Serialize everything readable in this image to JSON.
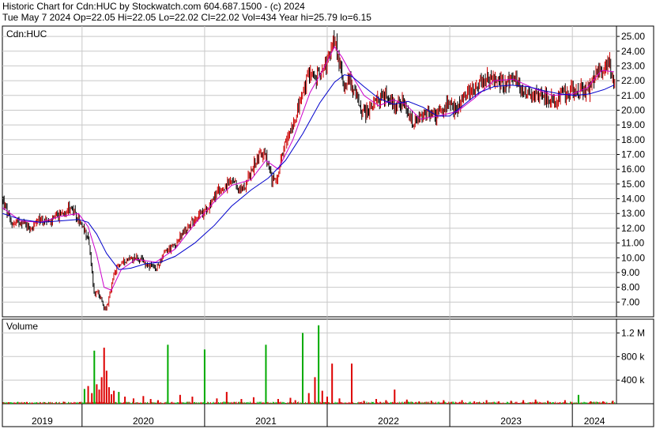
{
  "header": {
    "line1": "Historic Chart for Cdn:HUC by Stockwatch.com 604.687.1500 - (c) 2024",
    "line2": "Tue May  7 2024  Op=22.05  Hi=22.05  Lo=22.02  Cl=22.02  Vol=434  Year hi=25.79  lo=6.15"
  },
  "colors": {
    "candle_up": "#cc0000",
    "candle_down": "#000000",
    "ma_short": "#cc00cc",
    "ma_long": "#0000cc",
    "grid": "#c8c8c8",
    "vol_green": "#00aa00",
    "vol_red": "#dd0000"
  },
  "chart_data": [
    {
      "type": "line",
      "panel": "price",
      "title": "Cdn:HUC",
      "y_ticks": [
        "7.00",
        "8.00",
        "9.00",
        "10.00",
        "11.00",
        "12.00",
        "13.00",
        "14.00",
        "15.00",
        "16.00",
        "17.00",
        "18.00",
        "19.00",
        "20.00",
        "21.00",
        "22.00",
        "23.00",
        "24.00",
        "25.00"
      ],
      "ylim": [
        6.0,
        25.7
      ],
      "x_ticks": [
        "2019",
        "2020",
        "2021",
        "2022",
        "2023",
        "2024"
      ],
      "x_tick_pos": [
        2019.6,
        2020.0,
        2021.0,
        2022.0,
        2023.0,
        2024.0
      ],
      "xlim": [
        2019.35,
        2024.36
      ],
      "grid": true,
      "series": [
        {
          "key": "close",
          "x": [
            2019.35,
            2019.42,
            2019.5,
            2019.58,
            2019.66,
            2019.74,
            2019.82,
            2019.9,
            2019.97,
            2020.05,
            2020.1,
            2020.13,
            2020.16,
            2020.18,
            2020.2,
            2020.22,
            2020.26,
            2020.3,
            2020.36,
            2020.44,
            2020.52,
            2020.6,
            2020.68,
            2020.76,
            2020.84,
            2020.92,
            2021.0,
            2021.08,
            2021.16,
            2021.22,
            2021.3,
            2021.38,
            2021.45,
            2021.5,
            2021.55,
            2021.6,
            2021.66,
            2021.72,
            2021.8,
            2021.86,
            2021.9,
            2021.94,
            2021.97,
            2022.0,
            2022.03,
            2022.06,
            2022.1,
            2022.14,
            2022.18,
            2022.24,
            2022.3,
            2022.36,
            2022.42,
            2022.48,
            2022.54,
            2022.6,
            2022.64,
            2022.7,
            2022.76,
            2022.82,
            2022.9,
            2022.98,
            2023.06,
            2023.12,
            2023.2,
            2023.28,
            2023.36,
            2023.44,
            2023.52,
            2023.6,
            2023.68,
            2023.76,
            2023.84,
            2023.92,
            2024.0,
            2024.06,
            2024.12,
            2024.18,
            2024.24,
            2024.3,
            2024.34
          ],
          "values": [
            14.0,
            12.3,
            12.5,
            12.0,
            12.6,
            12.4,
            12.9,
            13.5,
            12.5,
            11.4,
            7.5,
            7.8,
            7.0,
            6.5,
            6.7,
            7.2,
            8.8,
            9.5,
            9.9,
            10.0,
            9.6,
            9.2,
            10.4,
            10.9,
            11.8,
            12.7,
            13.1,
            14.2,
            14.8,
            15.1,
            14.5,
            15.8,
            17.2,
            16.8,
            15.1,
            15.7,
            17.7,
            19.2,
            21.0,
            22.8,
            22.0,
            22.6,
            23.2,
            23.2,
            23.9,
            25.0,
            23.0,
            21.8,
            22.1,
            20.8,
            19.8,
            20.2,
            20.7,
            21.0,
            20.4,
            20.6,
            20.0,
            19.0,
            19.4,
            19.8,
            19.6,
            20.3,
            20.1,
            20.9,
            21.6,
            22.1,
            22.0,
            21.9,
            22.1,
            21.4,
            21.0,
            21.2,
            20.6,
            21.0,
            21.3,
            21.4,
            21.2,
            22.3,
            22.8,
            23.4,
            22.0
          ],
          "name": ""
        },
        {
          "key": "ma_short",
          "x": [
            2019.35,
            2019.5,
            2019.66,
            2019.82,
            2019.97,
            2020.05,
            2020.12,
            2020.18,
            2020.24,
            2020.32,
            2020.44,
            2020.6,
            2020.76,
            2020.92,
            2021.08,
            2021.22,
            2021.38,
            2021.5,
            2021.6,
            2021.72,
            2021.86,
            2021.97,
            2022.06,
            2022.12,
            2022.2,
            2022.3,
            2022.42,
            2022.54,
            2022.64,
            2022.76,
            2022.9,
            2023.06,
            2023.2,
            2023.36,
            2023.52,
            2023.68,
            2023.84,
            2024.0,
            2024.12,
            2024.24,
            2024.34
          ],
          "values": [
            13.4,
            12.5,
            12.4,
            12.8,
            13.0,
            12.1,
            10.2,
            8.0,
            7.8,
            9.2,
            9.9,
            9.7,
            10.6,
            12.3,
            13.8,
            14.9,
            15.3,
            16.6,
            16.0,
            18.0,
            21.2,
            22.8,
            24.3,
            23.6,
            22.4,
            21.0,
            20.3,
            20.7,
            20.4,
            19.4,
            19.6,
            19.9,
            20.8,
            22.0,
            22.1,
            21.5,
            21.0,
            21.1,
            21.5,
            22.7,
            22.6
          ],
          "name": ""
        },
        {
          "key": "ma_long",
          "x": [
            2019.35,
            2019.5,
            2019.66,
            2019.82,
            2019.97,
            2020.05,
            2020.12,
            2020.2,
            2020.3,
            2020.4,
            2020.52,
            2020.64,
            2020.76,
            2020.92,
            2021.08,
            2021.22,
            2021.38,
            2021.52,
            2021.66,
            2021.8,
            2021.94,
            2022.06,
            2022.14,
            2022.2,
            2022.3,
            2022.42,
            2022.54,
            2022.66,
            2022.78,
            2022.9,
            2023.0,
            2023.12,
            2023.24,
            2023.36,
            2023.5,
            2023.64,
            2023.78,
            2023.9,
            2024.02,
            2024.14,
            2024.26,
            2024.34
          ],
          "values": [
            13.0,
            12.6,
            12.4,
            12.5,
            12.6,
            12.4,
            11.6,
            10.3,
            9.2,
            9.3,
            9.6,
            9.7,
            10.1,
            11.0,
            12.2,
            13.5,
            14.6,
            15.4,
            16.6,
            18.4,
            20.5,
            21.9,
            22.4,
            22.3,
            21.6,
            20.8,
            20.4,
            20.6,
            20.2,
            19.6,
            19.6,
            20.4,
            21.2,
            21.6,
            21.7,
            21.6,
            21.3,
            21.1,
            21.0,
            21.1,
            21.4,
            21.7
          ],
          "name": ""
        }
      ]
    },
    {
      "type": "bar",
      "panel": "volume",
      "title": "Volume",
      "y_ticks": [
        "400 k",
        "800 k",
        "1.2 M"
      ],
      "ylim": [
        0,
        1380000
      ],
      "x": [
        2019.4,
        2019.55,
        2019.7,
        2019.85,
        2019.98,
        2020.02,
        2020.05,
        2020.08,
        2020.1,
        2020.12,
        2020.14,
        2020.16,
        2020.18,
        2020.2,
        2020.22,
        2020.24,
        2020.26,
        2020.3,
        2020.35,
        2020.42,
        2020.5,
        2020.56,
        2020.62,
        2020.7,
        2020.8,
        2020.9,
        2021.0,
        2021.1,
        2021.18,
        2021.3,
        2021.4,
        2021.5,
        2021.6,
        2021.7,
        2021.74,
        2021.8,
        2021.85,
        2021.9,
        2021.93,
        2021.96,
        2022.0,
        2022.04,
        2022.1,
        2022.2,
        2022.3,
        2022.4,
        2022.48,
        2022.55,
        2022.65,
        2022.75,
        2022.85,
        2022.95,
        2023.1,
        2023.2,
        2023.3,
        2023.4,
        2023.5,
        2023.6,
        2023.7,
        2023.8,
        2023.94,
        2024.05,
        2024.15,
        2024.25,
        2024.33
      ],
      "values": [
        25000,
        30000,
        20000,
        35000,
        28000,
        250000,
        300000,
        180000,
        900000,
        330000,
        240000,
        450000,
        950000,
        560000,
        280000,
        160000,
        220000,
        200000,
        120000,
        90000,
        130000,
        80000,
        60000,
        1000000,
        150000,
        120000,
        920000,
        90000,
        200000,
        80000,
        110000,
        1000000,
        80000,
        100000,
        60000,
        1200000,
        180000,
        450000,
        1330000,
        220000,
        120000,
        680000,
        90000,
        680000,
        50000,
        80000,
        60000,
        240000,
        70000,
        40000,
        50000,
        60000,
        60000,
        40000,
        60000,
        40000,
        50000,
        60000,
        70000,
        50000,
        60000,
        150000,
        40000,
        40000,
        50000
      ],
      "colors": [
        "r",
        "r",
        "r",
        "r",
        "r",
        "g",
        "r",
        "r",
        "g",
        "r",
        "r",
        "r",
        "r",
        "r",
        "r",
        "r",
        "r",
        "g",
        "r",
        "r",
        "r",
        "r",
        "r",
        "g",
        "r",
        "r",
        "g",
        "r",
        "r",
        "r",
        "r",
        "g",
        "r",
        "r",
        "r",
        "g",
        "r",
        "r",
        "g",
        "r",
        "r",
        "r",
        "r",
        "r",
        "r",
        "r",
        "r",
        "r",
        "r",
        "r",
        "r",
        "r",
        "r",
        "r",
        "r",
        "r",
        "r",
        "r",
        "r",
        "r",
        "r",
        "g",
        "r",
        "r",
        "r"
      ],
      "name": ""
    }
  ]
}
